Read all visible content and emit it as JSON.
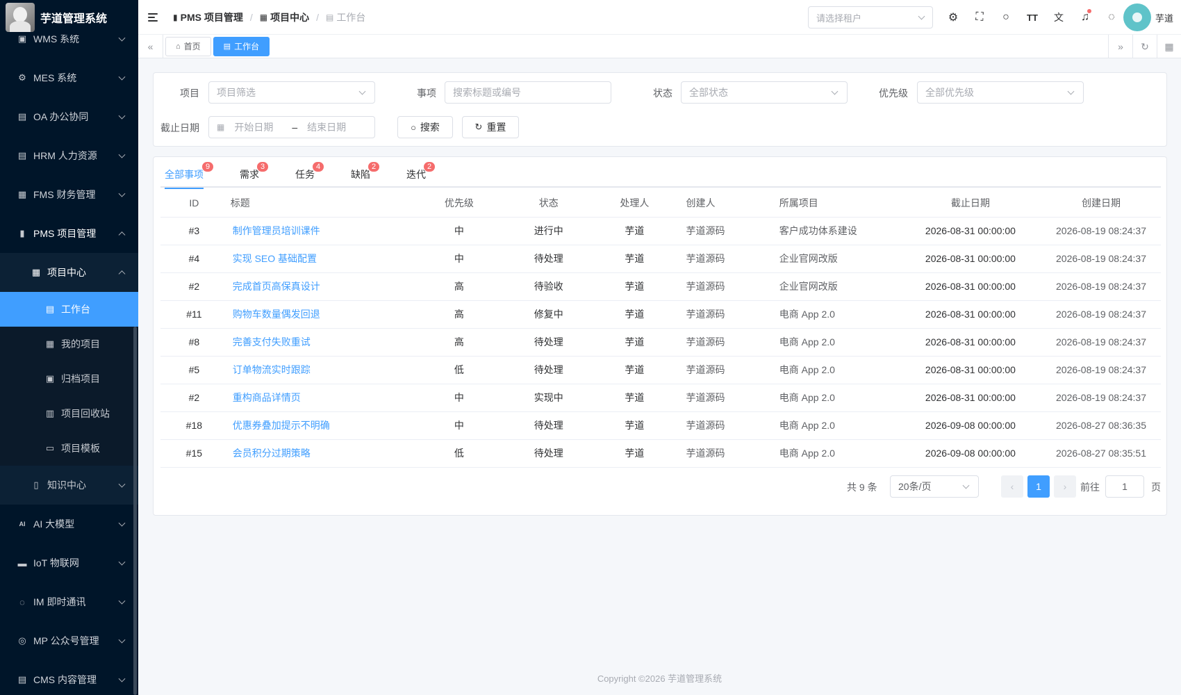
{
  "app": {
    "title": "芋道管理系统"
  },
  "sidebar": {
    "items": [
      {
        "label": "WMS 系统",
        "icon": "warehouse-icon"
      },
      {
        "label": "MES 系统",
        "icon": "gear-icon"
      },
      {
        "label": "OA 办公协同",
        "icon": "building-icon"
      },
      {
        "label": "HRM 人力资源",
        "icon": "building-icon"
      },
      {
        "label": "FMS 财务管理",
        "icon": "money-icon"
      },
      {
        "label": "PMS 项目管理",
        "icon": "chart-icon"
      }
    ],
    "project_center": "项目中心",
    "leaves": [
      "工作台",
      "我的项目",
      "归档项目",
      "项目回收站",
      "项目模板"
    ],
    "knowledge": "知识中心",
    "bottom_items": [
      {
        "label": "AI 大模型",
        "icon": "ai-icon"
      },
      {
        "label": "IoT 物联网",
        "icon": "iot-icon"
      },
      {
        "label": "IM 即时通讯",
        "icon": "chat-icon"
      },
      {
        "label": "MP 公众号管理",
        "icon": "compass-icon"
      },
      {
        "label": "CMS 内容管理",
        "icon": "doc-icon"
      }
    ]
  },
  "header": {
    "breadcrumb": [
      "PMS 项目管理",
      "项目中心",
      "工作台"
    ],
    "tenant_placeholder": "请选择租户",
    "username": "芋道"
  },
  "tags": {
    "home": "首页",
    "workbench": "工作台"
  },
  "filter": {
    "project_label": "项目",
    "project_placeholder": "项目筛选",
    "item_label": "事项",
    "item_placeholder": "搜索标题或编号",
    "status_label": "状态",
    "status_placeholder": "全部状态",
    "priority_label": "优先级",
    "priority_placeholder": "全部优先级",
    "date_label": "截止日期",
    "start_placeholder": "开始日期",
    "end_placeholder": "结束日期",
    "dash": "–",
    "search": "搜索",
    "reset": "重置"
  },
  "tabs": [
    {
      "label": "全部事项",
      "count": "9"
    },
    {
      "label": "需求",
      "count": "3"
    },
    {
      "label": "任务",
      "count": "4"
    },
    {
      "label": "缺陷",
      "count": "2"
    },
    {
      "label": "迭代",
      "count": "2"
    }
  ],
  "table": {
    "headers": [
      "ID",
      "标题",
      "优先级",
      "状态",
      "处理人",
      "创建人",
      "所属项目",
      "截止日期",
      "创建日期"
    ],
    "rows": [
      [
        "#3",
        "制作管理员培训课件",
        "中",
        "进行中",
        "芋道",
        "芋道源码",
        "客户成功体系建设",
        "2026-08-31 00:00:00",
        "2026-08-19 08:24:37"
      ],
      [
        "#4",
        "实现 SEO 基础配置",
        "中",
        "待处理",
        "芋道",
        "芋道源码",
        "企业官网改版",
        "2026-08-31 00:00:00",
        "2026-08-19 08:24:37"
      ],
      [
        "#2",
        "完成首页高保真设计",
        "高",
        "待验收",
        "芋道",
        "芋道源码",
        "企业官网改版",
        "2026-08-31 00:00:00",
        "2026-08-19 08:24:37"
      ],
      [
        "#11",
        "购物车数量偶发回退",
        "高",
        "修复中",
        "芋道",
        "芋道源码",
        "电商 App 2.0",
        "2026-08-31 00:00:00",
        "2026-08-19 08:24:37"
      ],
      [
        "#8",
        "完善支付失败重试",
        "高",
        "待处理",
        "芋道",
        "芋道源码",
        "电商 App 2.0",
        "2026-08-31 00:00:00",
        "2026-08-19 08:24:37"
      ],
      [
        "#5",
        "订单物流实时跟踪",
        "低",
        "待处理",
        "芋道",
        "芋道源码",
        "电商 App 2.0",
        "2026-08-31 00:00:00",
        "2026-08-19 08:24:37"
      ],
      [
        "#2",
        "重构商品详情页",
        "中",
        "实现中",
        "芋道",
        "芋道源码",
        "电商 App 2.0",
        "2026-08-31 00:00:00",
        "2026-08-19 08:24:37"
      ],
      [
        "#18",
        "优惠券叠加提示不明确",
        "中",
        "待处理",
        "芋道",
        "芋道源码",
        "电商 App 2.0",
        "2026-09-08 00:00:00",
        "2026-08-27 08:36:35"
      ],
      [
        "#15",
        "会员积分过期策略",
        "低",
        "待处理",
        "芋道",
        "芋道源码",
        "电商 App 2.0",
        "2026-09-08 00:00:00",
        "2026-08-27 08:35:51"
      ]
    ]
  },
  "pager": {
    "total": "共 9 条",
    "size": "20条/页",
    "page": "1",
    "goto": "前往",
    "goto_value": "1",
    "unit": "页"
  },
  "footer": "Copyright ©2026 芋道管理系统",
  "colors": {
    "accent": "#409eff",
    "sidebar_bg": "#001529",
    "badge": "#f56c6c"
  }
}
